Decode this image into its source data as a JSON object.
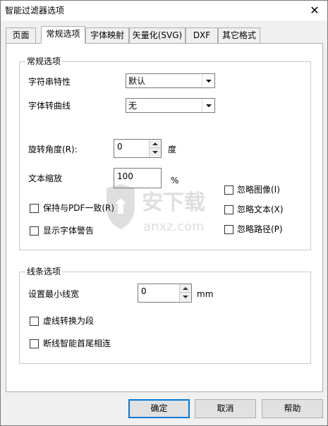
{
  "window": {
    "title": "智能过滤器选项",
    "close_glyph": "✕"
  },
  "tabs": [
    "页面",
    "常规选项",
    "字体映射",
    "矢量化(SVG)",
    "DXF",
    "其它格式"
  ],
  "general": {
    "group_label": "常规选项",
    "string_props_label": "字符串特性",
    "string_props_value": "默认",
    "font_to_curve_label": "字体转曲线",
    "font_to_curve_value": "无",
    "rotation_label": "旋转角度(R):",
    "rotation_value": "0",
    "rotation_unit": "度",
    "text_scale_label": "文本缩放",
    "text_scale_value": "100",
    "text_scale_unit": "%",
    "keep_pdf_label": "保持与PDF一致(R)",
    "show_font_warning_label": "显示字体警告",
    "ignore_images_label": "忽略图像(I)",
    "ignore_text_label": "忽略文本(X)",
    "ignore_paths_label": "忽略路径(P)"
  },
  "line": {
    "group_label": "线条选项",
    "min_width_label": "设置最小线宽",
    "min_width_value": "0",
    "min_width_unit": "mm",
    "dashed_to_segments_label": "虚线转换为段",
    "broken_join_label": "断线智能首尾相连"
  },
  "buttons": {
    "ok": "确定",
    "cancel": "取消",
    "help": "帮助"
  },
  "watermark": {
    "cn": "安下载",
    "en": "anxz.com"
  }
}
